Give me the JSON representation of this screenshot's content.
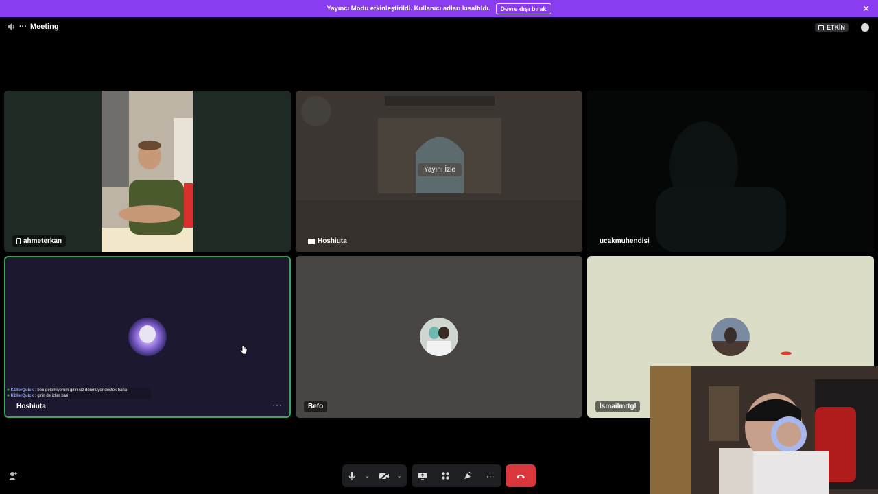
{
  "banner": {
    "message": "Yayıncı Modu etkinleştirildi. Kullanıcı adları kısaltıldı.",
    "disable_button": "Devre dışı bırak",
    "close_icon": "close-icon",
    "color": "#8a3df0"
  },
  "header": {
    "title": "Meeting",
    "title_prefix": "···",
    "status_badge": "ETKİN"
  },
  "tiles": [
    {
      "name": "ahmeterkan",
      "icon": "phone-icon",
      "state": "video"
    },
    {
      "name": "Hoshiuta",
      "icon": "stream-icon",
      "state": "stream",
      "action": "Yayını İzle"
    },
    {
      "name": "ucakmuhendisi",
      "state": "video",
      "speaking": true
    },
    {
      "name": "Hoshiuta",
      "state": "avatar",
      "speaking": true,
      "menu": "···"
    },
    {
      "name": "Befo",
      "state": "avatar"
    },
    {
      "name": "İsmailmrtgl",
      "state": "avatar"
    }
  ],
  "chat_overlay": [
    {
      "user": "K1llerQuick",
      "text": ": ben gelemiyorum girin siz dönmüyor destek bana"
    },
    {
      "user": "K1llerQuick",
      "text": ": girin de izlim bari"
    }
  ],
  "controls": {
    "icons": [
      "microphone-icon",
      "camera-off-icon",
      "screen-share-icon",
      "activities-icon",
      "soundboard-icon",
      "more-icon",
      "leave-call-icon"
    ],
    "more_label": "···",
    "leave_color": "#da373c"
  },
  "accent": {
    "speaking": "#3ba55c"
  }
}
